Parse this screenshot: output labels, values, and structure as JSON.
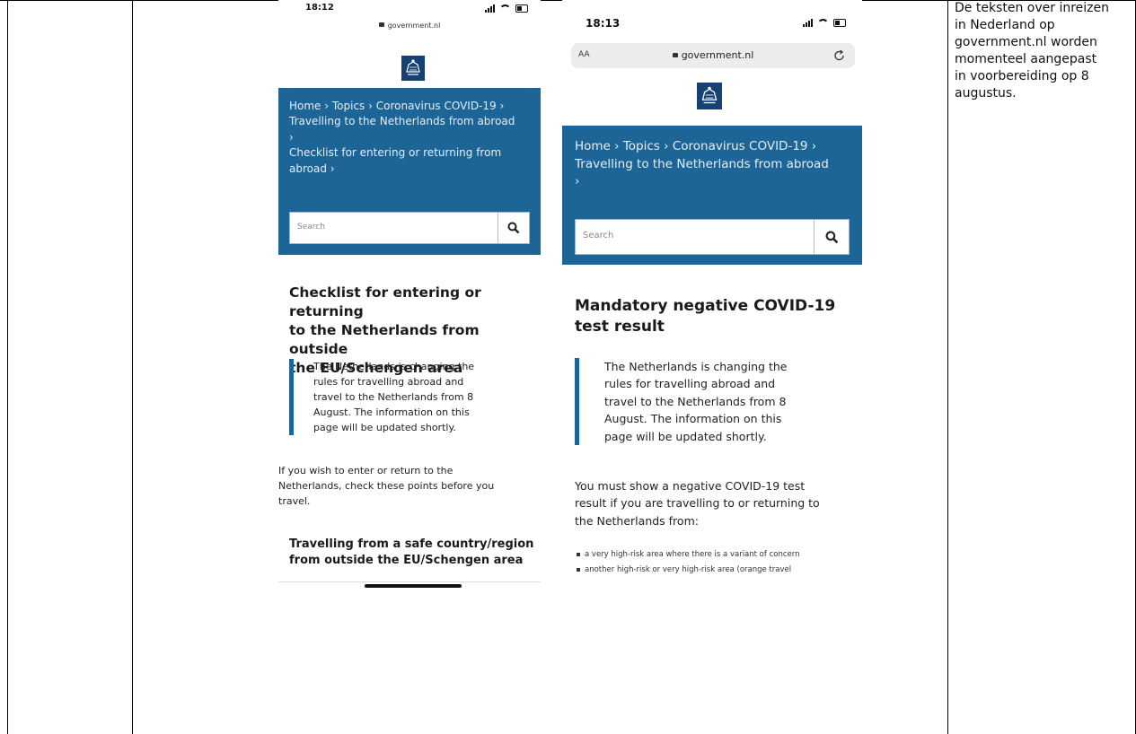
{
  "note": {
    "lines": [
      "De teksten over inreizen",
      "in Nederland op",
      "government.nl worden",
      "momenteel aangepast",
      "in voorbereiding op 8",
      "augustus."
    ]
  },
  "left_phone": {
    "time": "18:12",
    "url": "government.nl",
    "breadcrumb": [
      "Home › Topics › Coronavirus COVID-19 ›",
      "Travelling to the Netherlands from abroad",
      "›",
      "Checklist for entering or returning from",
      "abroad ›"
    ],
    "search_placeholder": "Search",
    "heading": [
      "Checklist for entering or returning",
      "to the Netherlands from outside",
      "the EU/Schengen area"
    ],
    "notice": [
      "The Netherlands is changing the",
      "rules for travelling abroad and",
      "travel to the Netherlands from 8",
      "August. The information on this",
      "page will be updated shortly."
    ],
    "paragraph": [
      "If you wish to enter or return to the",
      "Netherlands, check these points before you",
      "travel."
    ],
    "subheading": [
      "Travelling from a safe country/region",
      "from outside the EU/Schengen area"
    ]
  },
  "right_phone": {
    "time": "18:13",
    "text_size_label": "AA",
    "url": "government.nl",
    "breadcrumb": [
      "Home › Topics › Coronavirus COVID-19 ›",
      "Travelling to the Netherlands from abroad",
      "›"
    ],
    "search_placeholder": "Search",
    "heading": [
      "Mandatory negative COVID-19",
      "test result"
    ],
    "notice": [
      "The Netherlands is changing the",
      "rules for travelling abroad and",
      "travel to the Netherlands from 8",
      "August. The information on this",
      "page will be updated shortly."
    ],
    "paragraph": [
      "You must show a negative COVID-19 test",
      "result if you are travelling to or returning to",
      "the Netherlands from:"
    ],
    "bullets": [
      "a very high-risk area where there is a variant of concern",
      "another high-risk or very high-risk area (orange travel"
    ]
  }
}
